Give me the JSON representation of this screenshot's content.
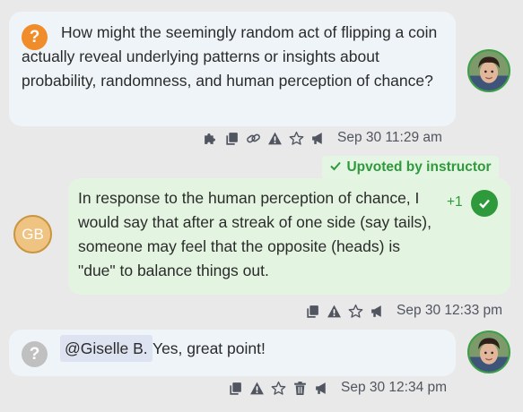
{
  "question": {
    "badge": "?",
    "text": "How might the seemingly random act of flipping a coin actually reveal underlying patterns or insights about probability, randomness, and human perception of chance?",
    "timestamp": "Sep 30 11:29 am",
    "actions": [
      "puzzle-icon",
      "copy-icon",
      "link-icon",
      "warning-icon",
      "star-icon",
      "megaphone-icon"
    ]
  },
  "answer": {
    "endorsement": "Upvoted by instructor",
    "author_initials": "GB",
    "text": "In response to the human perception of chance, I would say that after a streak of one side (say tails), someone may feel that the opposite (heads) is \"due\" to balance things out.",
    "votes": "+1",
    "timestamp": "Sep 30 12:33 pm",
    "actions": [
      "copy-icon",
      "warning-icon",
      "star-icon",
      "megaphone-icon"
    ]
  },
  "reply": {
    "badge": "?",
    "mention": "@Giselle B.",
    "text": "Yes, great point!",
    "timestamp": "Sep 30 12:34 pm",
    "actions": [
      "copy-icon",
      "warning-icon",
      "star-icon",
      "trash-icon",
      "megaphone-icon"
    ]
  },
  "colors": {
    "accent_orange": "#f08c2a",
    "success_green": "#2f9a3b",
    "question_bg": "#eef4f8",
    "answer_bg": "#e3f5e1"
  }
}
